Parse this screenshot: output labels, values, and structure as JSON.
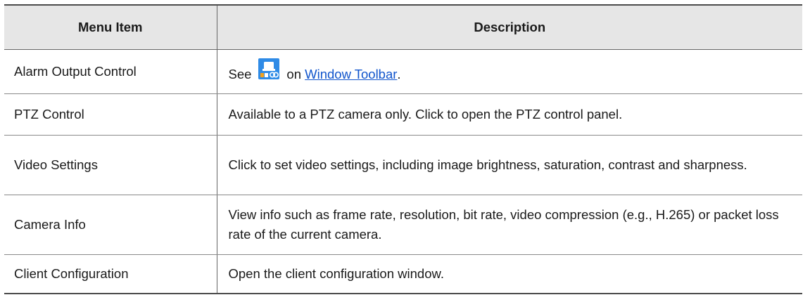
{
  "table": {
    "headers": {
      "menu_item": "Menu Item",
      "description": "Description"
    },
    "rows": [
      {
        "menu_item": "Alarm Output Control",
        "see_prefix": "See",
        "icon": "alarm-output-control-icon",
        "on_text": "on",
        "link_text": "Window Toolbar",
        "suffix": "."
      },
      {
        "menu_item": "PTZ Control",
        "description": "Available to a PTZ camera only. Click to open the PTZ control panel."
      },
      {
        "menu_item": "Video Settings",
        "description": "Click to set video settings, including image brightness, saturation, contrast and sharpness."
      },
      {
        "menu_item": "Camera Info",
        "description": "View info such as frame rate, resolution, bit rate, video compression (e.g., H.265) or packet loss rate of the current camera."
      },
      {
        "menu_item": "Client Configuration",
        "description": "Open the client configuration window."
      }
    ]
  },
  "colors": {
    "header_bg": "#e6e6e6",
    "link": "#1155cc",
    "icon_blue": "#2f8be6",
    "icon_orange": "#f5a21b"
  }
}
